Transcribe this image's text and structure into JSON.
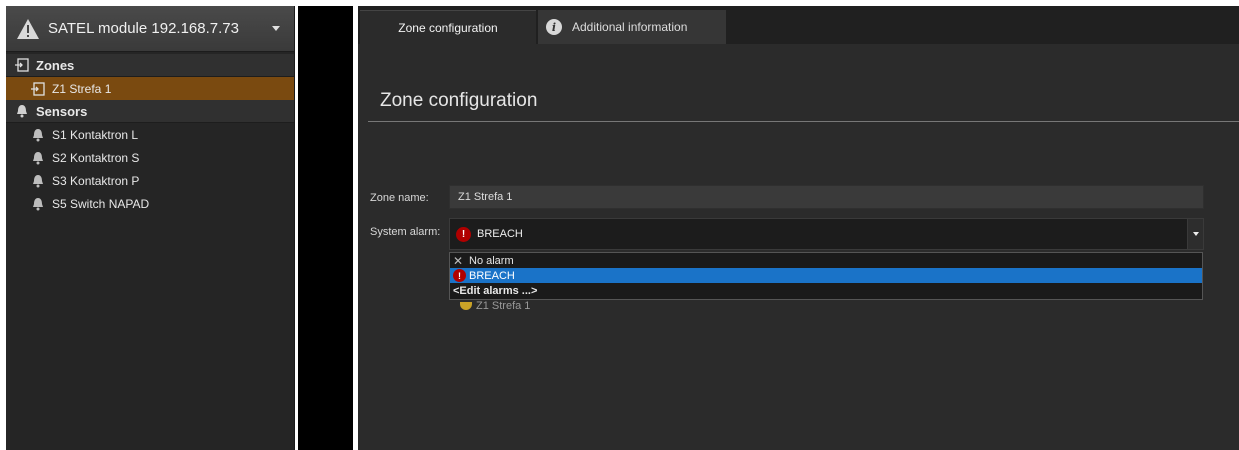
{
  "sidebar": {
    "module_title": "SATEL module 192.168.7.73",
    "tree": [
      {
        "type": "group",
        "label": "Zones",
        "icon": "zone-icon"
      },
      {
        "type": "child",
        "label": "Z1 Strefa 1",
        "icon": "zone-icon",
        "selected": true
      },
      {
        "type": "group",
        "label": "Sensors",
        "icon": "bell-icon"
      },
      {
        "type": "child",
        "label": "S1 Kontaktron L",
        "icon": "bell-icon"
      },
      {
        "type": "child",
        "label": "S2 Kontaktron S",
        "icon": "bell-icon"
      },
      {
        "type": "child",
        "label": "S3 Kontaktron P",
        "icon": "bell-icon"
      },
      {
        "type": "child",
        "label": "S5 Switch NAPAD",
        "icon": "bell-icon"
      }
    ]
  },
  "tabs": {
    "active_label": "Zone configuration",
    "info_label": "Additional information",
    "info_glyph": "i"
  },
  "main": {
    "section_title": "Zone configuration",
    "zone_name_label": "Zone name:",
    "zone_name_value": "Z1 Strefa 1",
    "system_alarm_label": "System alarm:",
    "system_alarm_value": "BREACH",
    "alarm_glyph": "!",
    "dropdown_options": [
      "No alarm",
      "BREACH",
      "<Edit alarms ...>"
    ],
    "peek_text": "Z1 Strefa 1"
  },
  "colors": {
    "selected_row": "#7a4a10",
    "highlight": "#1a73c8",
    "alarm_red": "#b00000"
  }
}
